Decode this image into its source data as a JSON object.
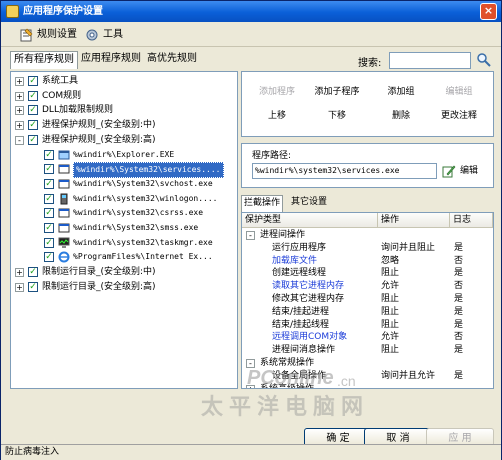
{
  "window": {
    "title": "应用程序保护设置",
    "close": "×"
  },
  "menu": {
    "rules": "规则设置",
    "tools": "工具"
  },
  "tabs": [
    "所有程序规则",
    "应用程序规则",
    "高优先规则"
  ],
  "search": {
    "label": "搜索:",
    "value": ""
  },
  "tree": [
    {
      "label": "系统工具",
      "level": 0,
      "expander": "+",
      "checked": true,
      "icon": "none"
    },
    {
      "label": "COM规则",
      "level": 0,
      "expander": "+",
      "checked": true,
      "icon": "none"
    },
    {
      "label": "DLL加载限制规则",
      "level": 0,
      "expander": "+",
      "checked": true,
      "icon": "none"
    },
    {
      "label": "进程保护规则_(安全级别:中)",
      "level": 0,
      "expander": "+",
      "checked": true,
      "icon": "none"
    },
    {
      "label": "进程保护规则_(安全级别:高)",
      "level": 0,
      "expander": "-",
      "checked": true,
      "icon": "none"
    },
    {
      "label": "%windir%\\Explorer.EXE",
      "level": 1,
      "checked": true,
      "icon": "explorer-icon",
      "mono": true
    },
    {
      "label": "%windir%\\System32\\services....",
      "level": 1,
      "checked": true,
      "icon": "exe-icon",
      "mono": true,
      "selected": true
    },
    {
      "label": "%windir%\\System32\\svchost.exe",
      "level": 1,
      "checked": true,
      "icon": "exe-icon",
      "mono": true
    },
    {
      "label": "%windir%\\system32\\winlogon....",
      "level": 1,
      "checked": true,
      "icon": "winlogon-icon",
      "mono": true
    },
    {
      "label": "%windir%\\system32\\csrss.exe",
      "level": 1,
      "checked": true,
      "icon": "exe-icon",
      "mono": true
    },
    {
      "label": "%windir%\\System32\\smss.exe",
      "level": 1,
      "checked": true,
      "icon": "exe-icon",
      "mono": true
    },
    {
      "label": "%windir%\\system32\\taskmgr.exe",
      "level": 1,
      "checked": true,
      "icon": "taskmgr-icon",
      "mono": true
    },
    {
      "label": "%ProgramFiles%\\Internet Ex...",
      "level": 1,
      "checked": true,
      "icon": "ie-icon",
      "mono": true
    },
    {
      "label": "限制运行目录_(安全级别:中)",
      "level": 0,
      "expander": "+",
      "checked": true,
      "icon": "none"
    },
    {
      "label": "限制运行目录_(安全级别:高)",
      "level": 0,
      "expander": "+",
      "checked": true,
      "icon": "none"
    }
  ],
  "buttons": {
    "add_program": "添加程序",
    "add_subprogram": "添加子程序",
    "add_group": "添加组",
    "edit_group": "编辑组",
    "move_up": "上移",
    "move_down": "下移",
    "delete": "删除",
    "change_note": "更改注释"
  },
  "path": {
    "label": "程序路径:",
    "value": "%windir%\\system32\\services.exe",
    "edit": "编辑"
  },
  "subtabs": [
    "拦截操作",
    "其它设置"
  ],
  "grid": {
    "headers": [
      "保护类型",
      "操作",
      "日志"
    ],
    "rows": [
      {
        "type": "进程间操作",
        "action": "",
        "log": "",
        "group": true,
        "exp": "-"
      },
      {
        "type": "运行应用程序",
        "action": "询问并且阻止",
        "log": "是"
      },
      {
        "type": "加载库文件",
        "action": "忽略",
        "log": "否",
        "blue": true
      },
      {
        "type": "创建远程线程",
        "action": "阻止",
        "log": "是"
      },
      {
        "type": "读取其它进程内存",
        "action": "允许",
        "log": "否",
        "blue": true
      },
      {
        "type": "修改其它进程内存",
        "action": "阻止",
        "log": "是"
      },
      {
        "type": "结束/挂起进程",
        "action": "阻止",
        "log": "是"
      },
      {
        "type": "结束/挂起线程",
        "action": "阻止",
        "log": "是"
      },
      {
        "type": "远程调用COM对象",
        "action": "允许",
        "log": "否",
        "blue": true
      },
      {
        "type": "进程间消息操作",
        "action": "阻止",
        "log": "是"
      },
      {
        "type": "系统常规操作",
        "action": "",
        "log": "",
        "group": true,
        "exp": "-"
      },
      {
        "type": "设备全局操作",
        "action": "询问并且允许",
        "log": "是"
      },
      {
        "type": "系统高级操作",
        "action": "",
        "log": "",
        "group": true,
        "exp": "+"
      }
    ]
  },
  "footer": {
    "ok": "确 定",
    "cancel": "取 消",
    "apply": "应 用"
  },
  "status": "防止病毒注入",
  "watermark": {
    "line1": "PConline",
    "line2": ".cn",
    "line3": "太平洋电脑网"
  }
}
